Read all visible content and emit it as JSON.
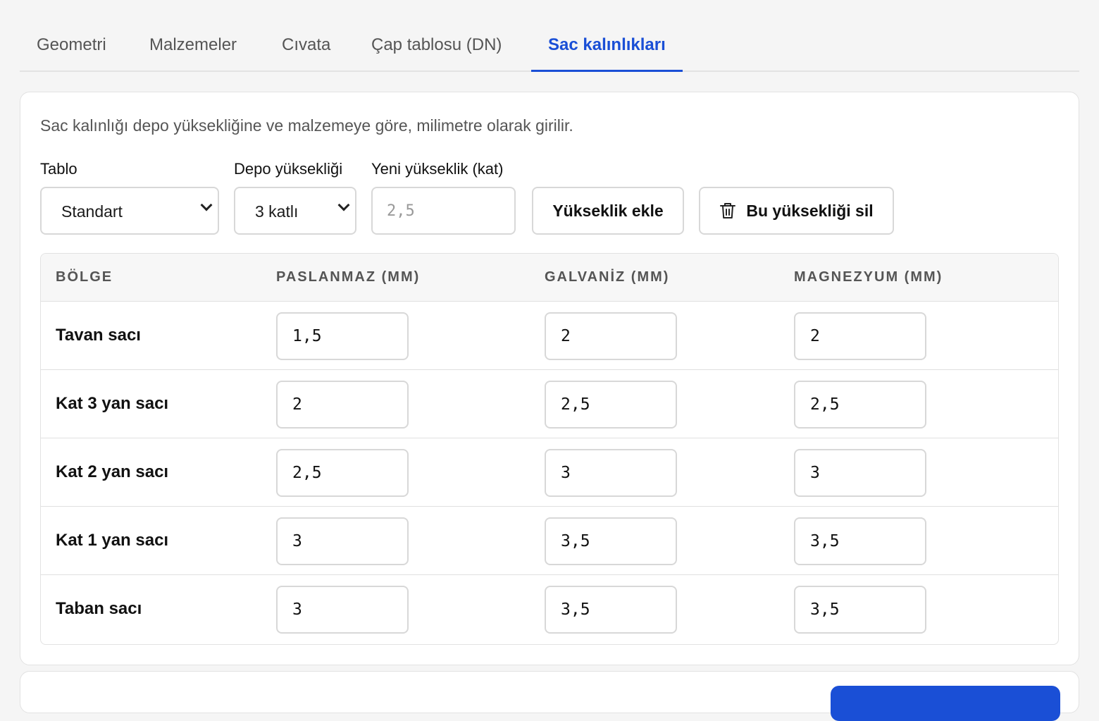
{
  "tabs": [
    {
      "label": "Geometri",
      "active": false
    },
    {
      "label": "Malzemeler",
      "active": false
    },
    {
      "label": "Cıvata",
      "active": false
    },
    {
      "label": "Çap tablosu (DN)",
      "active": false
    },
    {
      "label": "Sac kalınlıkları",
      "active": true
    }
  ],
  "description": "Sac kalınlığı depo yüksekliğine ve malzemeye göre, milimetre olarak girilir.",
  "controls": {
    "table_label": "Tablo",
    "table_value": "Standart",
    "height_label": "Depo yüksekliği",
    "height_value": "3 katlı",
    "new_height_label": "Yeni yükseklik (kat)",
    "new_height_placeholder": "2,5",
    "add_height_button": "Yükseklik ekle",
    "delete_height_button": "Bu yüksekliği sil"
  },
  "table": {
    "headers": [
      "BÖLGE",
      "PASLANMAZ (MM)",
      "GALVANİZ (MM)",
      "MAGNEZYUM (MM)"
    ],
    "rows": [
      {
        "label": "Tavan sacı",
        "values": [
          "1,5",
          "2",
          "2"
        ]
      },
      {
        "label": "Kat 3 yan sacı",
        "values": [
          "2",
          "2,5",
          "2,5"
        ]
      },
      {
        "label": "Kat 2 yan sacı",
        "values": [
          "2,5",
          "3",
          "3"
        ]
      },
      {
        "label": "Kat 1 yan sacı",
        "values": [
          "3",
          "3,5",
          "3,5"
        ]
      },
      {
        "label": "Taban sacı",
        "values": [
          "3",
          "3,5",
          "3,5"
        ]
      }
    ]
  },
  "colors": {
    "accent": "#1a4fd6",
    "border": "#d8d8d8",
    "muted_text": "#555555"
  },
  "icons": {
    "delete": "trash-icon",
    "select": "chevron-down-icon"
  }
}
